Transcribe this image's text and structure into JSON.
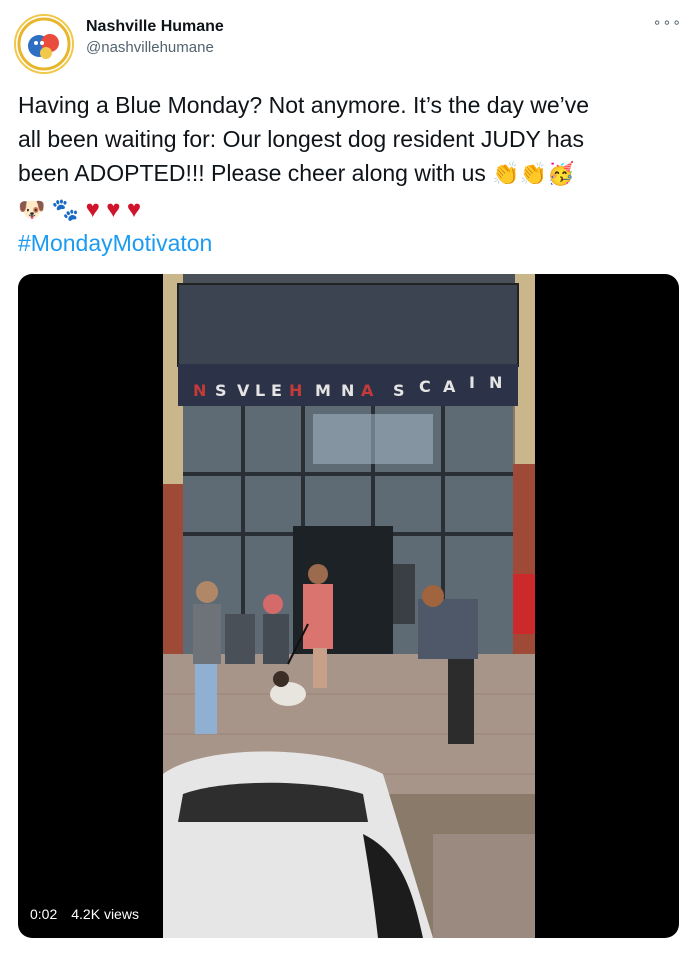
{
  "tweet": {
    "author": {
      "display_name": "Nashville Humane",
      "handle": "@nashvillehumane",
      "avatar": "nashville-humane-logo"
    },
    "more_icon": "more-options-icon",
    "text_line1": "Having a Blue Monday? Not anymore. It’s the day we’ve",
    "text_line2": "all been waiting for: Our longest dog resident JUDY has",
    "text_line3": "been ADOPTED!!! Please cheer along with us",
    "emojis": [
      "clapping-hands",
      "clapping-hands",
      "partying-face",
      "dog-face",
      "paw-prints",
      "red-heart",
      "red-heart",
      "red-heart"
    ],
    "hashtag": "#MondayMotivaton"
  },
  "video": {
    "time": "0:02",
    "views": "4.2K views",
    "building_sign": [
      "N",
      "S",
      "V",
      "L",
      "E",
      "H",
      "M",
      "N",
      "A",
      "S",
      "C",
      "A",
      "I",
      "N"
    ]
  },
  "colors": {
    "link": "#1d9bf0",
    "heart": "#d0142c",
    "sign_bg": "#2c3247"
  }
}
